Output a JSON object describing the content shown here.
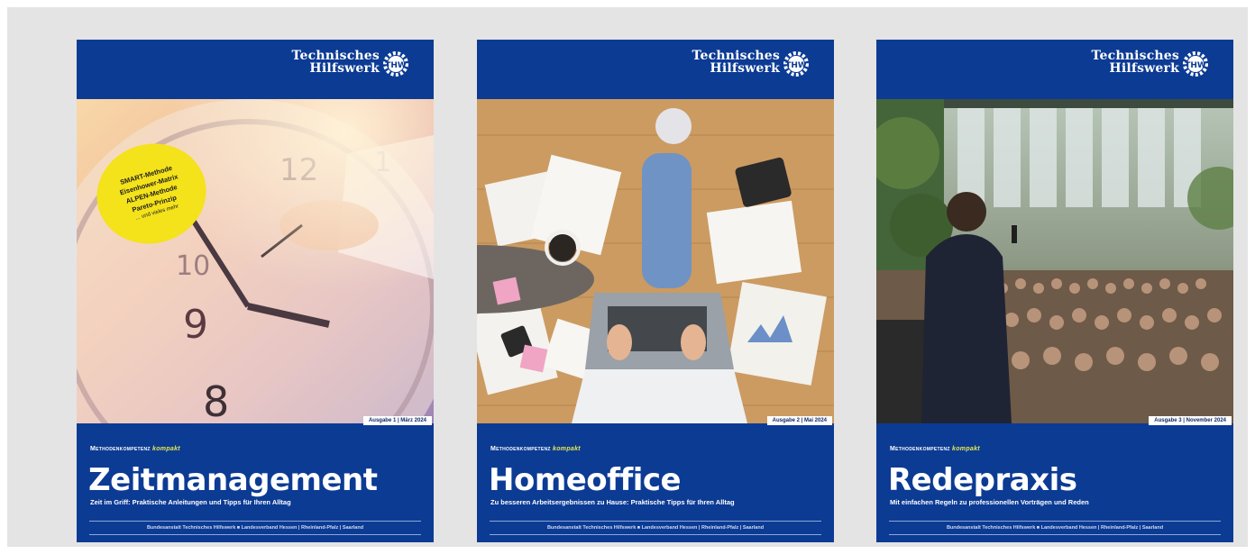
{
  "brand": {
    "line1": "Technisches",
    "line2": "Hilfswerk"
  },
  "series": {
    "label": "Methodenkompetenz",
    "accent": "kompakt"
  },
  "footer_text": "Bundesanstalt Technisches Hilfswerk ■ Landesverband Hessen | Rheinland-Pfalz | Saarland",
  "colors": {
    "thw_blue": "#0c3b94",
    "accent_yellow": "#e8e84a",
    "badge_yellow": "#f4e21b",
    "background": "#e4e4e4"
  },
  "covers": [
    {
      "title": "Zeitmanagement",
      "subtitle": "Zeit im Griff: Praktische Anleitungen und Tipps für Ihren Alltag",
      "issue": "Ausgabe 1 | März 2024",
      "badge": [
        "SMART-Methode",
        "Eisenhower-Matrix",
        "ALPEN-Methode",
        "Pareto-Prinzip",
        "… und vieles mehr"
      ],
      "image": "clock-and-hand-photo"
    },
    {
      "title": "Homeoffice",
      "subtitle": "Zu besseren Arbeitsergebnissen zu Hause: Praktische Tipps für Ihren Alltag",
      "issue": "Ausgabe 2 | Mai 2024",
      "image": "homeoffice-laptop-photo"
    },
    {
      "title": "Redepraxis",
      "subtitle": "Mit einfachen Regeln zu professionellen Vorträgen und Reden",
      "issue": "Ausgabe 3 | November 2024",
      "image": "speaker-audience-photo"
    }
  ]
}
